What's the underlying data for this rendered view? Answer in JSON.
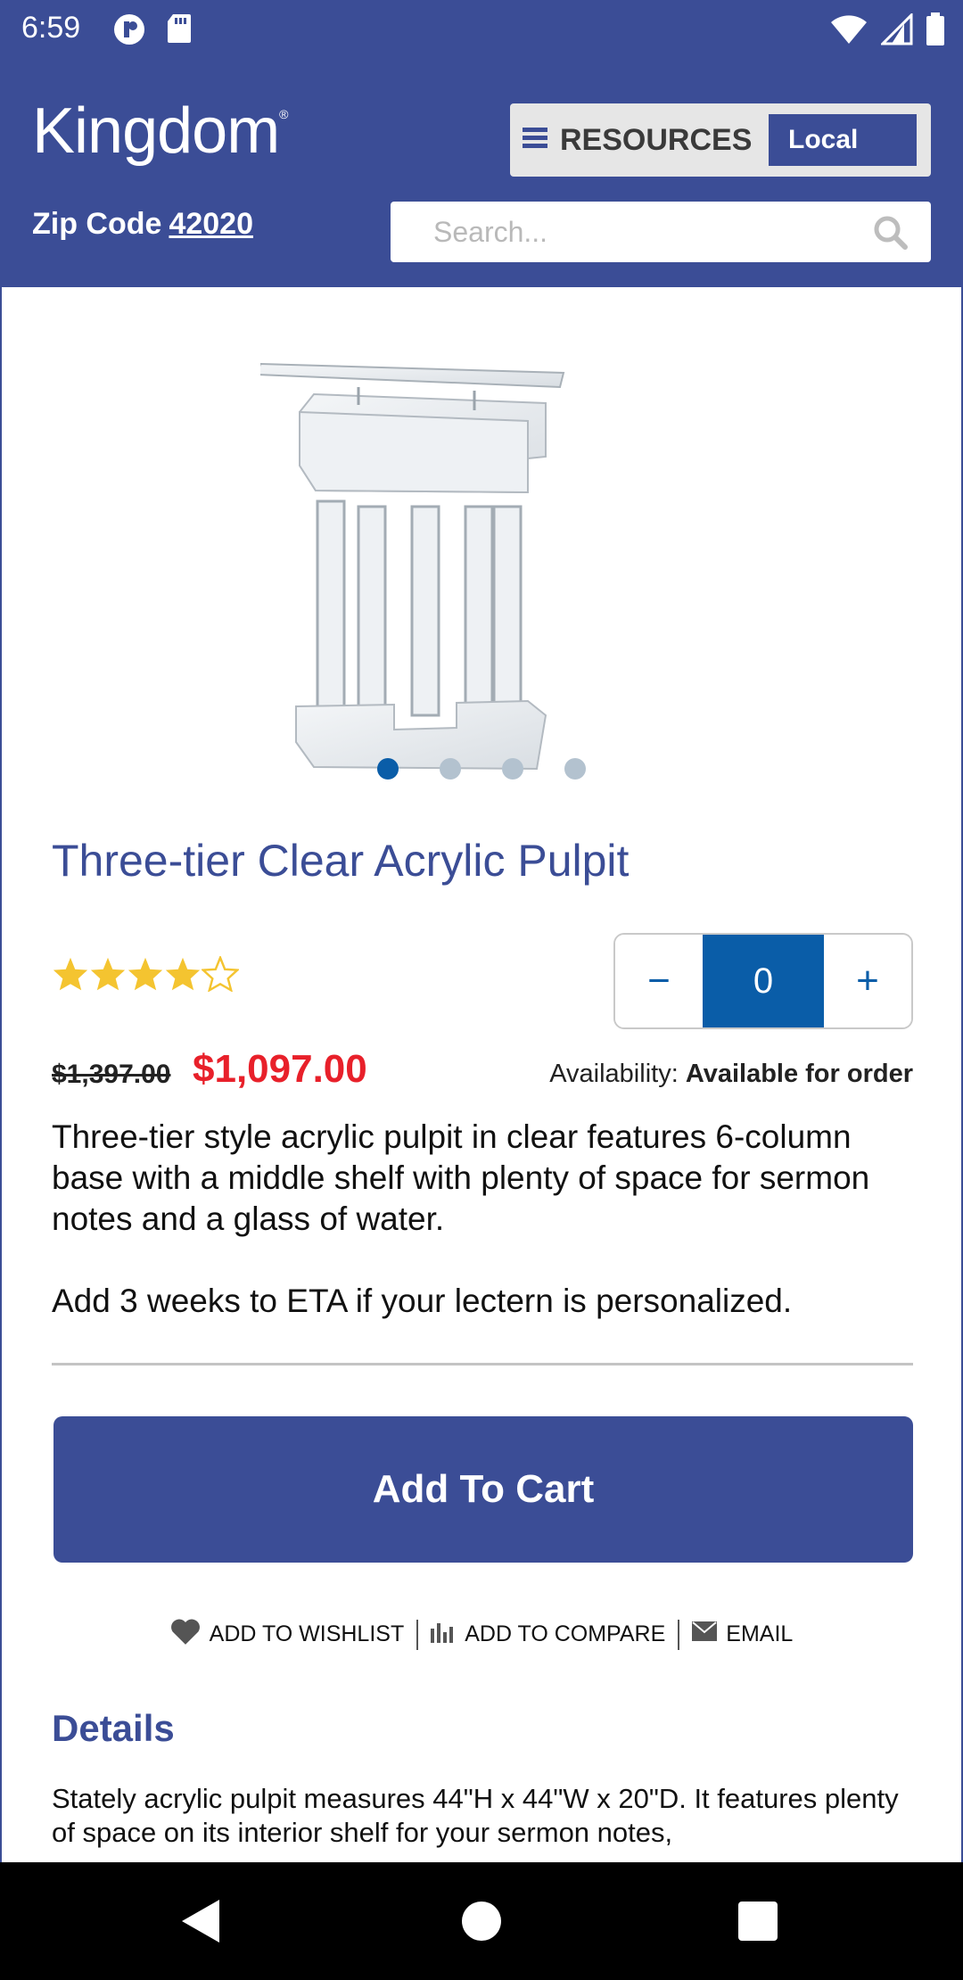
{
  "status_bar": {
    "time": "6:59"
  },
  "header": {
    "logo_text": "Kingdom",
    "logo_mark": "®",
    "resources_label": "RESOURCES",
    "local_label": "Local",
    "zip_label": "Zip Code",
    "zip_value": "42020",
    "search_placeholder": "Search..."
  },
  "product": {
    "title": "Three-tier Clear Acrylic Pulpit",
    "rating": 4.5,
    "rating_max": 5,
    "image_count": 4,
    "active_image": 0,
    "quantity": "0",
    "qty_minus": "−",
    "qty_plus": "+",
    "old_price": "$1,397.00",
    "price": "$1,097.00",
    "availability_label": "Availability:",
    "availability_value": "Available for order",
    "description_1": "Three-tier style acrylic pulpit in clear features 6-column base with a middle shelf with plenty of space for sermon notes and a glass of water.",
    "description_2": "Add 3 weeks to ETA if your lectern is personalized.",
    "add_to_cart": "Add To Cart",
    "actions": {
      "wishlist": "ADD TO WISHLIST",
      "compare": "ADD TO COMPARE",
      "email": "EMAIL"
    },
    "details_heading": "Details",
    "details_text": "Stately acrylic pulpit measures 44\"H x 44\"W x 20\"D. It features plenty of space on its interior shelf for your sermon notes,"
  },
  "colors": {
    "brand": "#3b4d96",
    "accent": "#0a5da8",
    "sale": "#e8202a",
    "star": "#f4c430"
  }
}
